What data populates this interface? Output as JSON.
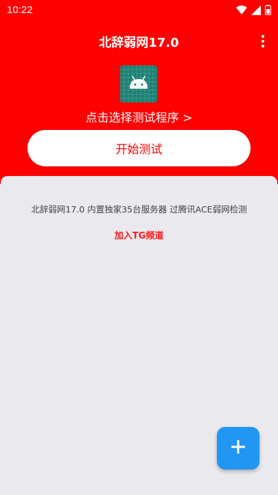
{
  "status_bar": {
    "time": "10:22",
    "icons": [
      "wifi-icon",
      "signal-icon",
      "battery-icon"
    ]
  },
  "app_bar": {
    "title": "北辞弱网17.0",
    "menu_icon": "more-vert-icon"
  },
  "program_selector": {
    "icon": "android-icon",
    "label": "点击选择测试程序 >"
  },
  "start_button": {
    "label": "开始测试"
  },
  "content": {
    "info": "北辞弱网17.0 内置独家35台服务器 过腾讯ACE弱网检测",
    "tg_link": "加入TG频道"
  },
  "fab": {
    "icon": "plus-icon"
  },
  "colors": {
    "primary": "#ff0000",
    "background": "#e9e9ee",
    "fab": "#2196f3",
    "app_icon_bg": "#1f7f72"
  }
}
